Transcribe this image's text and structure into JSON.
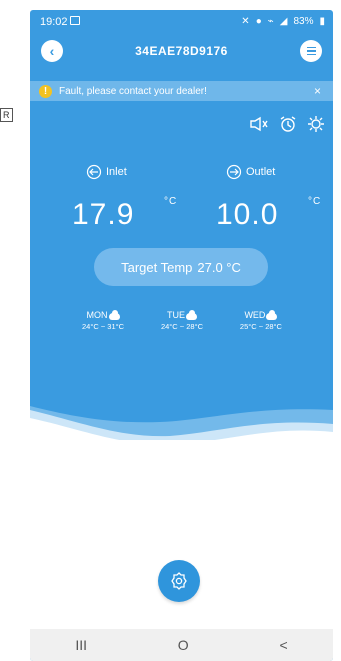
{
  "edge": {
    "label": "R"
  },
  "status_bar": {
    "time": "19:02",
    "battery": "83%"
  },
  "header": {
    "title": "34EAE78D9176"
  },
  "fault": {
    "message": "Fault, please contact your dealer!",
    "close": "×"
  },
  "tools": [
    "mute-icon",
    "alarm-clock-icon",
    "sun-icon"
  ],
  "readings": {
    "inlet_label": "Inlet",
    "outlet_label": "Outlet",
    "inlet_value": "17.9",
    "outlet_value": "10.0",
    "unit": "°C"
  },
  "target": {
    "label": "Target Temp",
    "value": "27.0 °C"
  },
  "forecast": [
    {
      "day": "MON",
      "range": "24°C ~ 31°C",
      "icon": "cloud-icon"
    },
    {
      "day": "TUE",
      "range": "24°C ~ 28°C",
      "icon": "cloud-icon"
    },
    {
      "day": "WED",
      "range": "25°C ~ 28°C",
      "icon": "cloud-icon"
    }
  ],
  "nav": {
    "recents": "III",
    "home": "O",
    "back": "<"
  },
  "colors": {
    "primary": "#3a9be0",
    "pill": "#74b9ec",
    "fault": "#f3c222",
    "fab": "#2f95dc"
  }
}
